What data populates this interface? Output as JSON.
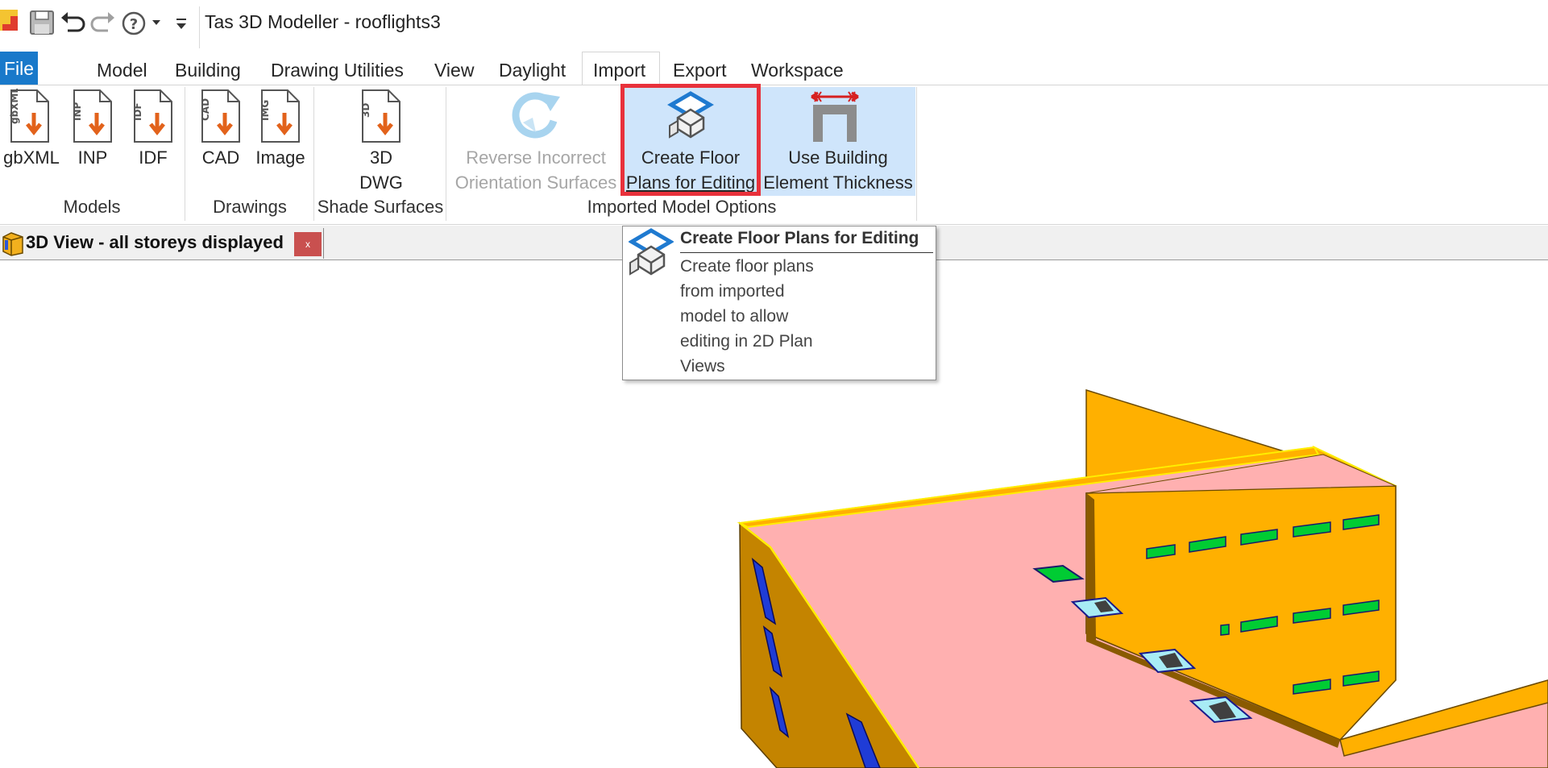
{
  "window": {
    "title": "Tas 3D Modeller - rooflights3"
  },
  "quick_access": {
    "icons": [
      "app-logo-icon",
      "save-icon",
      "undo-icon",
      "redo-icon",
      "help-icon",
      "dropdown-arrow-icon",
      "customize-qat-icon"
    ]
  },
  "menu": {
    "file": "File",
    "tabs": [
      "Model",
      "Building",
      "Drawing Utilities",
      "View",
      "Daylight",
      "Import",
      "Export",
      "Workspace"
    ],
    "active_tab": "Import"
  },
  "ribbon": {
    "groups": [
      {
        "label": "Models",
        "buttons": [
          {
            "label": "gbXML",
            "icon_text": "gbXML"
          },
          {
            "label": "INP",
            "icon_text": "INP"
          },
          {
            "label": "IDF",
            "icon_text": "IDF"
          }
        ]
      },
      {
        "label": "Drawings",
        "buttons": [
          {
            "label": "CAD",
            "icon_text": "CAD"
          },
          {
            "label": "Image",
            "icon_text": "IMG"
          }
        ]
      },
      {
        "label": "Shade Surfaces",
        "buttons": [
          {
            "label_line1": "3D",
            "label_line2": "DWG",
            "icon_text": "3D"
          }
        ]
      },
      {
        "label": "Imported Model Options",
        "buttons": [
          {
            "label_line1": "Reverse Incorrect",
            "label_line2": "Orientation Surfaces",
            "disabled": true
          },
          {
            "label_line1": "Create Floor",
            "label_line2": "Plans for Editing"
          },
          {
            "label_line1": "Use Building",
            "label_line2": "Element Thickness"
          }
        ]
      }
    ]
  },
  "document_tab": {
    "title": "3D View - all storeys displayed",
    "close": "x"
  },
  "tooltip": {
    "title": "Create Floor Plans for Editing",
    "lines": [
      "Create floor plans",
      "from imported",
      "model to allow",
      "editing in 2D Plan",
      "Views"
    ]
  },
  "colors": {
    "file_tab": "#1979ca",
    "highlight": "#cfe5fb",
    "red_outline": "#e8313b",
    "roof": "#ffb0b0",
    "wall": "#ffb000",
    "window_glass": "#00cc33",
    "rooflight": "#a8ecf5",
    "edge": "#ffee00"
  }
}
